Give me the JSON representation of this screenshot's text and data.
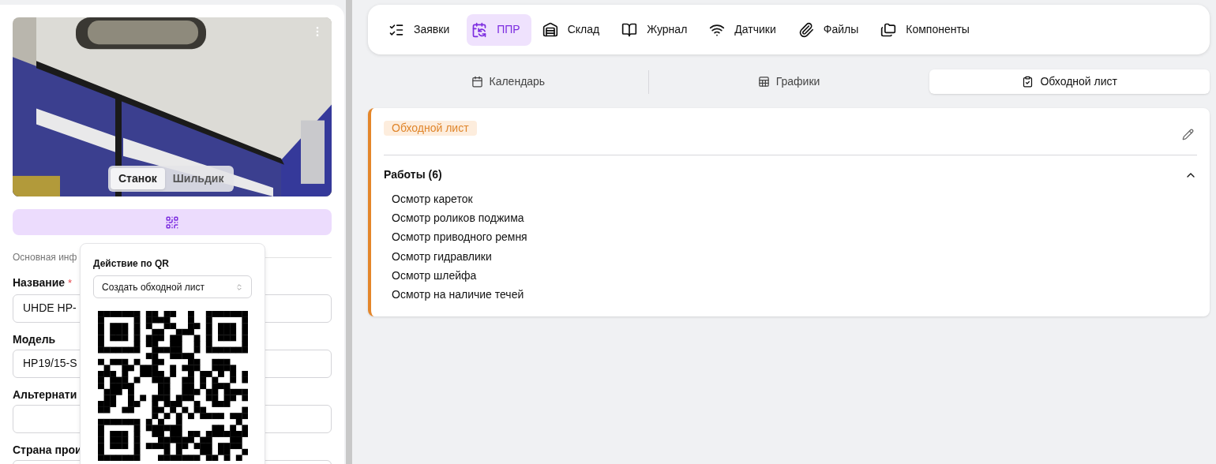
{
  "left_panel": {
    "photo_toggle": [
      {
        "label": "Станок",
        "selected": true
      },
      {
        "label": "Шильдик",
        "selected": false
      }
    ],
    "section_label": "Основная инф",
    "fields": [
      {
        "label": "Название",
        "required_mark": "*",
        "value": "UHDE HP-"
      },
      {
        "label": "Модель",
        "value": "HP19/15-S"
      },
      {
        "label": "Альтернати"
      },
      {
        "label": "Страна прои"
      }
    ]
  },
  "qr_popover": {
    "title": "Действие по QR",
    "select_value": "Создать обходной лист"
  },
  "nav_tabs": [
    {
      "label": "Заявки",
      "kind": "checklist",
      "selected": false
    },
    {
      "label": "ППР",
      "kind": "calendar",
      "selected": true
    },
    {
      "label": "Склад",
      "kind": "warehouse",
      "selected": false
    },
    {
      "label": "Журнал",
      "kind": "book",
      "selected": false
    },
    {
      "label": "Датчики",
      "kind": "wifi",
      "selected": false
    },
    {
      "label": "Файлы",
      "kind": "paperclip",
      "selected": false
    },
    {
      "label": "Компоненты",
      "kind": "folders",
      "selected": false
    }
  ],
  "sub_tabs": [
    {
      "label": "Календарь",
      "kind": "calendar",
      "selected": false
    },
    {
      "label": "Графики",
      "kind": "table",
      "selected": false
    },
    {
      "label": "Обходной лист",
      "kind": "checklist",
      "selected": true
    }
  ],
  "card": {
    "tag": "Обходной лист",
    "section_title": "Работы (6)",
    "expanded": true,
    "items": [
      "Осмотр кареток",
      "Осмотр роликов поджима",
      "Осмотр приводного ремня",
      "Осмотр гидравлики",
      "Осмотр шлейфа",
      "Осмотр на наличие течей"
    ]
  }
}
